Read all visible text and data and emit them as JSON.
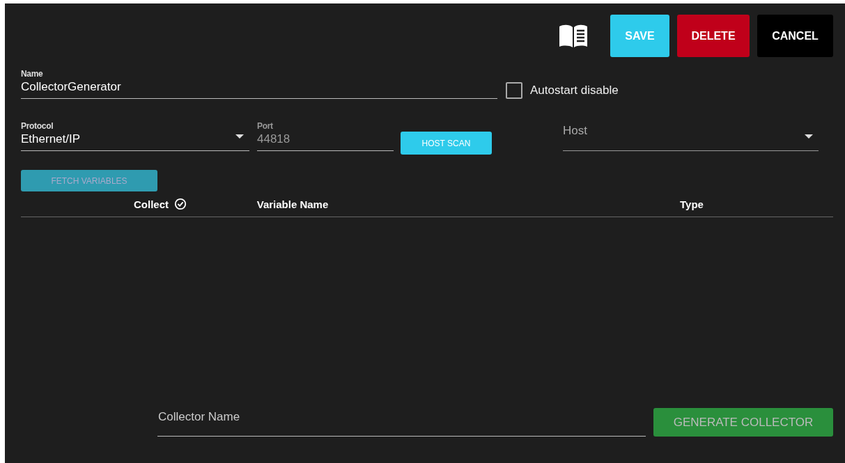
{
  "toolbar": {
    "buttons": [
      {
        "label": "SAVE",
        "kind": "save"
      },
      {
        "label": "DELETE",
        "kind": "delete"
      },
      {
        "label": "CANCEL",
        "kind": "cancel"
      }
    ]
  },
  "name_field": {
    "label": "Name",
    "value": "CollectorGenerator"
  },
  "autostart": {
    "label": "Autostart disable",
    "checked": false
  },
  "protocol": {
    "label": "Protocol",
    "value": "Ethernet/IP"
  },
  "port": {
    "label": "Port",
    "value": "44818"
  },
  "host_scan": {
    "label": "HOST SCAN"
  },
  "host": {
    "placeholder": "Host"
  },
  "fetch_variables": {
    "label": "FETCH VARIABLES",
    "disabled": true
  },
  "table": {
    "columns": [
      "Collect",
      "Variable Name",
      "Type"
    ]
  },
  "collector_name": {
    "placeholder": "Collector Name"
  },
  "generate": {
    "label": "GENERATE COLLECTOR",
    "disabled": true
  }
}
